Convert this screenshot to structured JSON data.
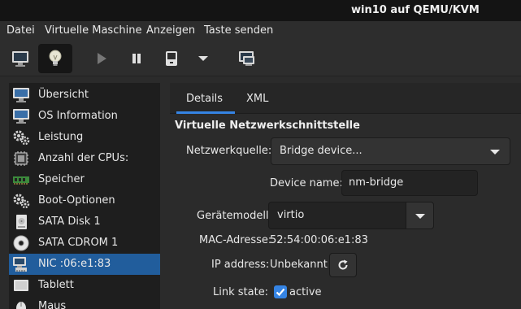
{
  "window": {
    "title": "win10 auf QEMU/KVM"
  },
  "menu": [
    "Datei",
    "Virtuelle Maschine",
    "Anzeigen",
    "Taste senden"
  ],
  "toolbar": {
    "icons": [
      "monitor-icon",
      "lightbulb-icon",
      "play-icon",
      "pause-icon",
      "shutdown-icon",
      "dropdown-arrow-icon",
      "snapshot-icon"
    ]
  },
  "sidebar": {
    "items": [
      {
        "label": "Übersicht",
        "icon": "monitor-icon"
      },
      {
        "label": "OS Information",
        "icon": "monitor-icon"
      },
      {
        "label": "Leistung",
        "icon": "gears-icon"
      },
      {
        "label": "Anzahl der CPUs:",
        "icon": "cpu-icon"
      },
      {
        "label": "Speicher",
        "icon": "memory-icon"
      },
      {
        "label": "Boot-Optionen",
        "icon": "gears-icon"
      },
      {
        "label": "SATA Disk 1",
        "icon": "disk-icon"
      },
      {
        "label": "SATA CDROM 1",
        "icon": "cdrom-icon"
      },
      {
        "label": "NIC :06:e1:83",
        "icon": "network-icon",
        "selected": true
      },
      {
        "label": "Tablett",
        "icon": "tablet-icon"
      },
      {
        "label": "Maus",
        "icon": "mouse-icon"
      }
    ]
  },
  "tabs": [
    {
      "label": "Details",
      "active": true
    },
    {
      "label": "XML",
      "active": false
    }
  ],
  "nic": {
    "section_title": "Virtuelle Netzwerkschnittstelle",
    "source_label": "Netzwerkquelle:",
    "source_value": "Bridge device...",
    "device_name_label": "Device name:",
    "device_name_value": "nm-bridge",
    "model_label": "Gerätemodell:",
    "model_value": "virtio",
    "mac_label": "MAC-Adresse:",
    "mac_value": "52:54:00:06:e1:83",
    "ip_label": "IP address:",
    "ip_value": "Unbekannt",
    "link_label": "Link state:",
    "link_value": "active",
    "link_checked": true
  },
  "colors": {
    "accent": "#3584e4",
    "selection": "#215d9c",
    "titlebar": "#141414",
    "background": "#2b2b2b"
  }
}
